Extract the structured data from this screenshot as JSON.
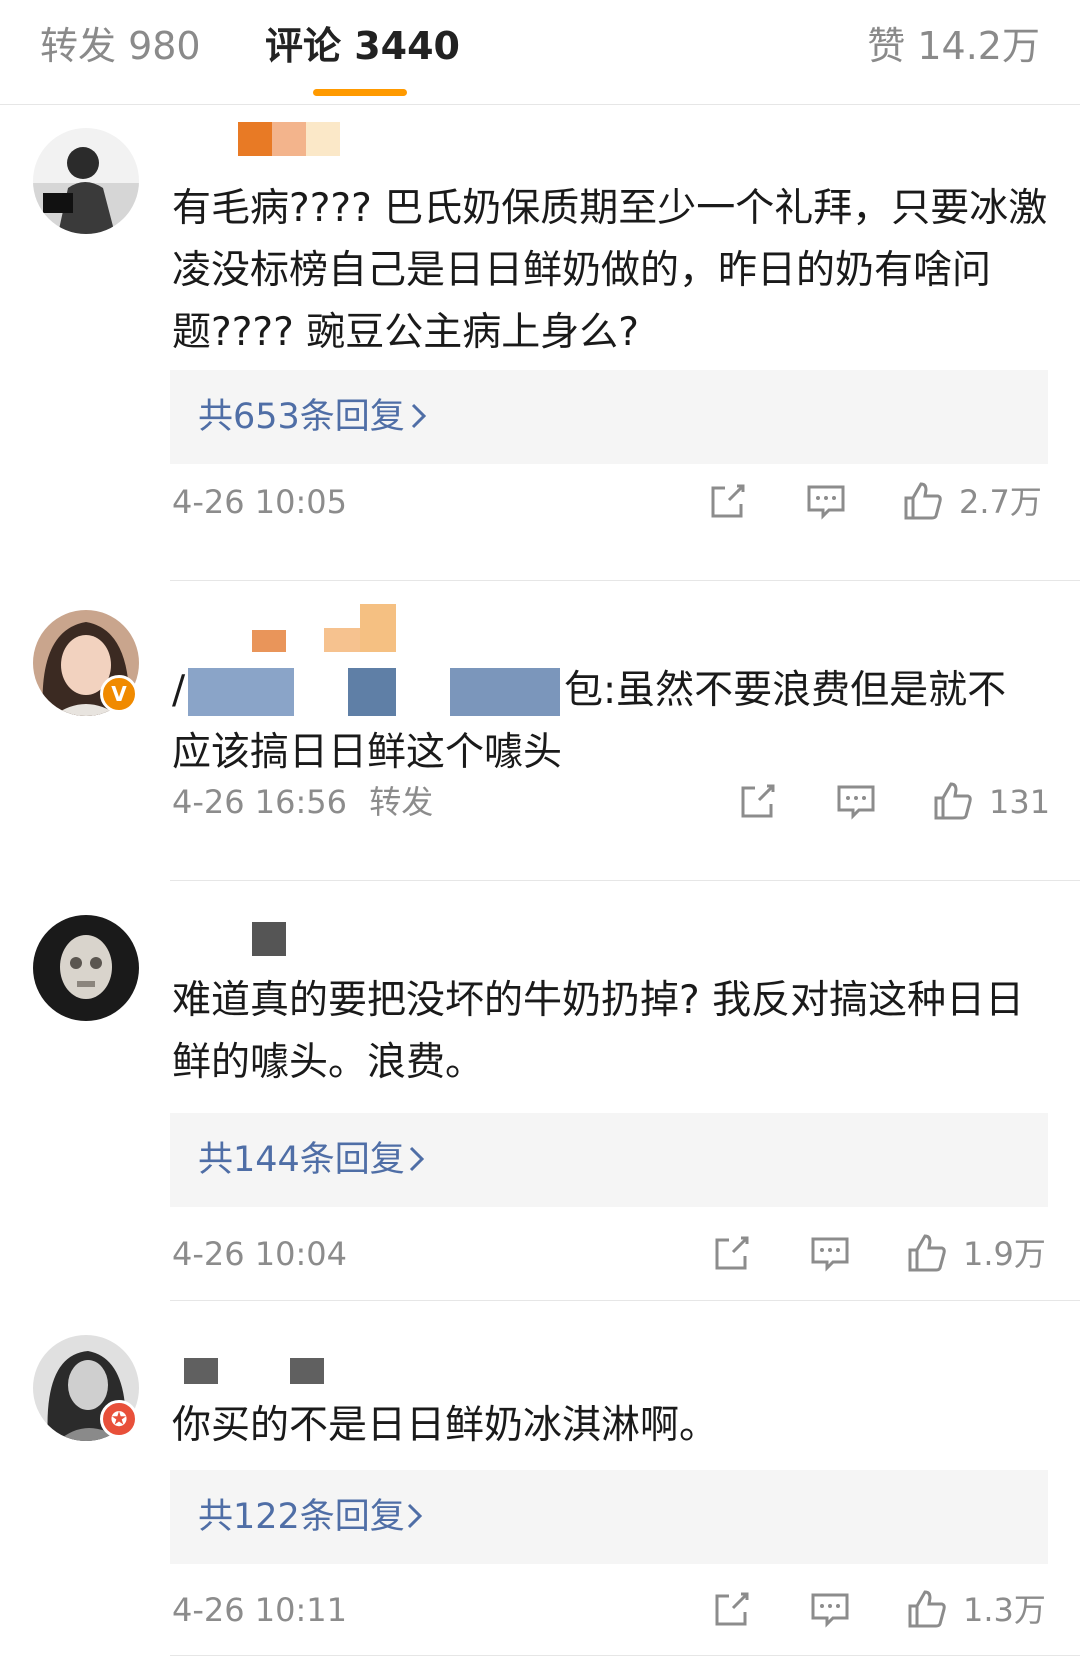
{
  "tabs": {
    "repost": "转发 980",
    "comment": "评论 3440",
    "like": "赞 14.2万"
  },
  "colors": {
    "accent": "#ff9a00",
    "link": "#4f6ea6",
    "muted": "#8c8c8c",
    "reply_bg": "#f5f5f5"
  },
  "comments": [
    {
      "text": "有毛病???? 巴氏奶保质期至少一个礼拜，只要冰激凌没标榜自己是日日鲜奶做的，昨日的奶有啥问题???? 豌豆公主病上身么?",
      "reply": "共653条回复",
      "time": "4-26 10:05",
      "likes": "2.7万",
      "icons": [
        "share-icon",
        "comment-icon",
        "thumbs-up-icon"
      ]
    },
    {
      "text_visible": "包:虽然不要浪费但是就不应该搞日日鲜这个噱头",
      "text_line1": "包:虽然不要浪费但是就不",
      "text_line2": "应该搞日日鲜这个噱头",
      "time": "4-26 16:56",
      "repost_label": "转发",
      "likes": "131",
      "badge": "V"
    },
    {
      "text": "难道真的要把没坏的牛奶扔掉? 我反对搞这种日日鲜的噱头。浪费。",
      "reply": "共144条回复",
      "time": "4-26 10:04",
      "likes": "1.9万"
    },
    {
      "text": "你买的不是日日鲜奶冰淇淋啊。",
      "reply": "共122条回复",
      "time": "4-26 10:11",
      "likes": "1.3万"
    }
  ]
}
